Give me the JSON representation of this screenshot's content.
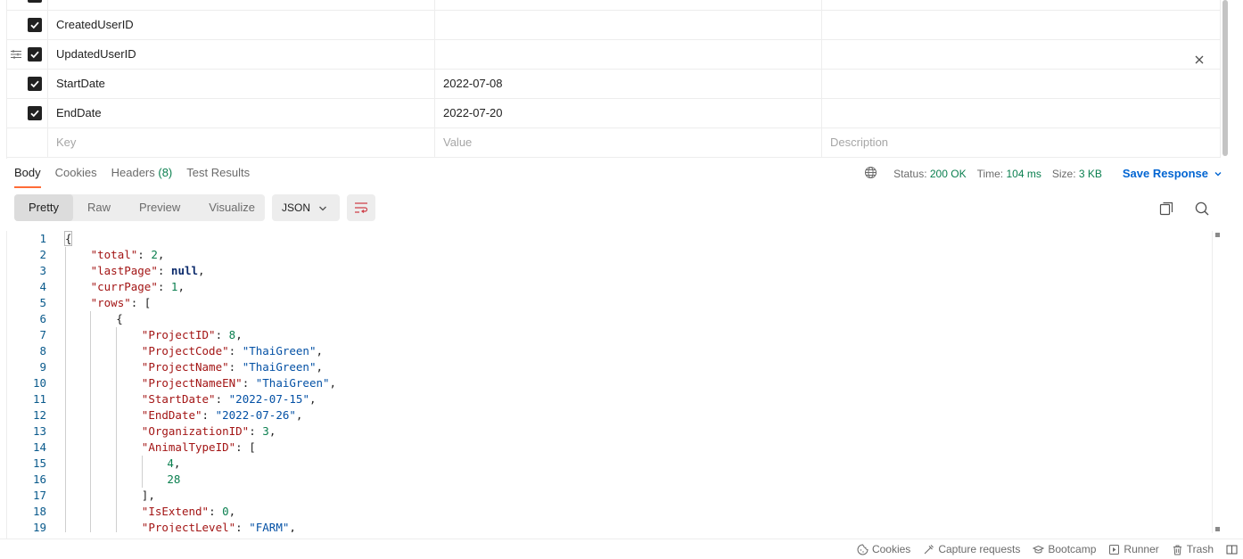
{
  "params": {
    "rows": [
      {
        "key": "CreatedUserID",
        "value": "",
        "description": "",
        "checked": true
      },
      {
        "key": "UpdatedUserID",
        "value": "",
        "description": "",
        "checked": true,
        "hover": true
      },
      {
        "key": "StartDate",
        "value": "2022-07-08",
        "description": "",
        "checked": true
      },
      {
        "key": "EndDate",
        "value": "2022-07-20",
        "description": "",
        "checked": true
      }
    ],
    "placeholder": {
      "key": "Key",
      "value": "Value",
      "description": "Description"
    }
  },
  "response": {
    "tabs": {
      "body": "Body",
      "cookies": "Cookies",
      "headers": "Headers",
      "headers_count": "(8)",
      "test_results": "Test Results"
    },
    "status_label": "Status:",
    "status_value": "200 OK",
    "time_label": "Time:",
    "time_value": "104 ms",
    "size_label": "Size:",
    "size_value": "3 KB",
    "save_label": "Save Response"
  },
  "view": {
    "tabs": {
      "pretty": "Pretty",
      "raw": "Raw",
      "preview": "Preview",
      "visualize": "Visualize"
    },
    "format": "JSON"
  },
  "code_lines": [
    {
      "n": "1",
      "indent": 0,
      "parts": [
        [
          "p",
          "{"
        ]
      ]
    },
    {
      "n": "2",
      "indent": 1,
      "parts": [
        [
          "k",
          "\"total\""
        ],
        [
          "p",
          ": "
        ],
        [
          "n",
          "2"
        ],
        [
          "p",
          ","
        ]
      ]
    },
    {
      "n": "3",
      "indent": 1,
      "parts": [
        [
          "k",
          "\"lastPage\""
        ],
        [
          "p",
          ": "
        ],
        [
          "kw",
          "null"
        ],
        [
          "p",
          ","
        ]
      ]
    },
    {
      "n": "4",
      "indent": 1,
      "parts": [
        [
          "k",
          "\"currPage\""
        ],
        [
          "p",
          ": "
        ],
        [
          "n",
          "1"
        ],
        [
          "p",
          ","
        ]
      ]
    },
    {
      "n": "5",
      "indent": 1,
      "parts": [
        [
          "k",
          "\"rows\""
        ],
        [
          "p",
          ": ["
        ]
      ]
    },
    {
      "n": "6",
      "indent": 2,
      "parts": [
        [
          "p",
          "{"
        ]
      ]
    },
    {
      "n": "7",
      "indent": 3,
      "parts": [
        [
          "k",
          "\"ProjectID\""
        ],
        [
          "p",
          ": "
        ],
        [
          "n",
          "8"
        ],
        [
          "p",
          ","
        ]
      ]
    },
    {
      "n": "8",
      "indent": 3,
      "parts": [
        [
          "k",
          "\"ProjectCode\""
        ],
        [
          "p",
          ": "
        ],
        [
          "s",
          "\"ThaiGreen\""
        ],
        [
          "p",
          ","
        ]
      ]
    },
    {
      "n": "9",
      "indent": 3,
      "parts": [
        [
          "k",
          "\"ProjectName\""
        ],
        [
          "p",
          ": "
        ],
        [
          "s",
          "\"ThaiGreen\""
        ],
        [
          "p",
          ","
        ]
      ]
    },
    {
      "n": "10",
      "indent": 3,
      "parts": [
        [
          "k",
          "\"ProjectNameEN\""
        ],
        [
          "p",
          ": "
        ],
        [
          "s",
          "\"ThaiGreen\""
        ],
        [
          "p",
          ","
        ]
      ]
    },
    {
      "n": "11",
      "indent": 3,
      "parts": [
        [
          "k",
          "\"StartDate\""
        ],
        [
          "p",
          ": "
        ],
        [
          "s",
          "\"2022-07-15\""
        ],
        [
          "p",
          ","
        ]
      ]
    },
    {
      "n": "12",
      "indent": 3,
      "parts": [
        [
          "k",
          "\"EndDate\""
        ],
        [
          "p",
          ": "
        ],
        [
          "s",
          "\"2022-07-26\""
        ],
        [
          "p",
          ","
        ]
      ]
    },
    {
      "n": "13",
      "indent": 3,
      "parts": [
        [
          "k",
          "\"OrganizationID\""
        ],
        [
          "p",
          ": "
        ],
        [
          "n",
          "3"
        ],
        [
          "p",
          ","
        ]
      ]
    },
    {
      "n": "14",
      "indent": 3,
      "parts": [
        [
          "k",
          "\"AnimalTypeID\""
        ],
        [
          "p",
          ": ["
        ]
      ]
    },
    {
      "n": "15",
      "indent": 4,
      "parts": [
        [
          "n",
          "4"
        ],
        [
          "p",
          ","
        ]
      ]
    },
    {
      "n": "16",
      "indent": 4,
      "parts": [
        [
          "n",
          "28"
        ]
      ]
    },
    {
      "n": "17",
      "indent": 3,
      "parts": [
        [
          "p",
          "],"
        ]
      ]
    },
    {
      "n": "18",
      "indent": 3,
      "parts": [
        [
          "k",
          "\"IsExtend\""
        ],
        [
          "p",
          ": "
        ],
        [
          "n",
          "0"
        ],
        [
          "p",
          ","
        ]
      ]
    },
    {
      "n": "19",
      "indent": 3,
      "parts": [
        [
          "k",
          "\"ProjectLevel\""
        ],
        [
          "p",
          ": "
        ],
        [
          "s",
          "\"FARM\""
        ],
        [
          "p",
          ","
        ]
      ]
    }
  ],
  "statusbar": {
    "cookies": "Cookies",
    "capture": "Capture requests",
    "bootcamp": "Bootcamp",
    "runner": "Runner",
    "trash": "Trash"
  }
}
